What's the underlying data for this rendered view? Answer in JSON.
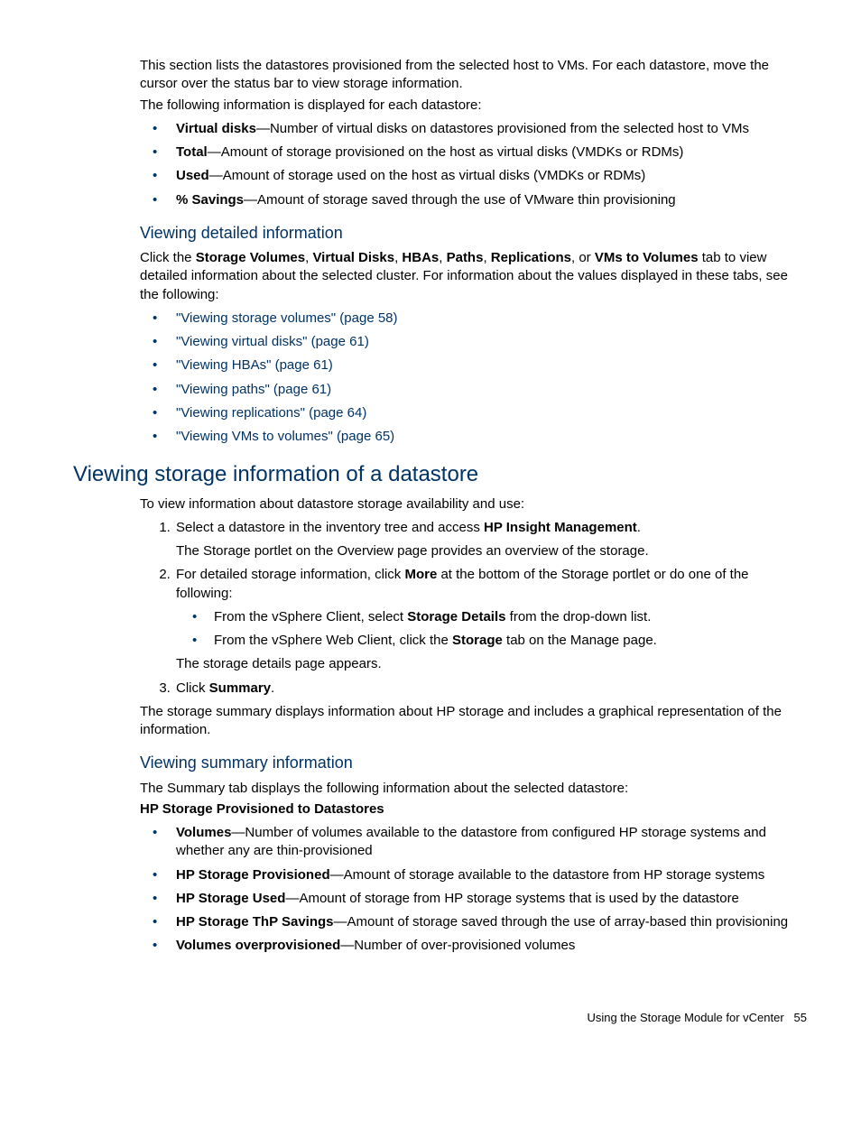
{
  "intro1": "This section lists the datastores provisioned from the selected host to VMs. For each datastore, move the cursor over the status bar to view storage information.",
  "intro2": "The following information is displayed for each datastore:",
  "list1": [
    {
      "term": "Virtual disks",
      "desc": "—Number of virtual disks on datastores provisioned from the selected host to VMs"
    },
    {
      "term": "Total",
      "desc": "—Amount of storage provisioned on the host as virtual disks (VMDKs or RDMs)"
    },
    {
      "term": "Used",
      "desc": "—Amount of storage used on the host as virtual disks (VMDKs or RDMs)"
    },
    {
      "term": "% Savings",
      "desc": "—Amount of storage saved through the use of VMware thin provisioning"
    }
  ],
  "h3_a": "Viewing detailed information",
  "detail_intro_pre": "Click the ",
  "detail_tabs": [
    "Storage Volumes",
    "Virtual Disks",
    "HBAs",
    "Paths",
    "Replications",
    "VMs to Volumes"
  ],
  "detail_intro_post": " tab to view detailed information about the selected cluster. For information about the values displayed in these tabs, see the following:",
  "links": [
    "\"Viewing storage volumes\" (page 58)",
    "\"Viewing virtual disks\" (page 61)",
    "\"Viewing HBAs\" (page 61)",
    "\"Viewing paths\" (page 61)",
    "\"Viewing replications\" (page 64)",
    "\"Viewing VMs to volumes\" (page 65)"
  ],
  "h2": "Viewing storage information of a datastore",
  "h2_intro": "To view information about datastore storage availability and use:",
  "step1_pre": "Select a datastore in the inventory tree and access ",
  "step1_bold": "HP Insight Management",
  "step1_post": ".",
  "step1_p": "The Storage portlet on the Overview page provides an overview of the storage.",
  "step2_pre": "For detailed storage information, click ",
  "step2_bold": "More",
  "step2_post": " at the bottom of the Storage portlet or do one of the following:",
  "step2_sub1_pre": "From the vSphere Client, select ",
  "step2_sub1_bold": "Storage Details",
  "step2_sub1_post": " from the drop-down list.",
  "step2_sub2_pre": "From the vSphere Web Client, click the ",
  "step2_sub2_bold": "Storage",
  "step2_sub2_post": " tab on the Manage page.",
  "step2_p": "The storage details page appears.",
  "step3_pre": "Click ",
  "step3_bold": "Summary",
  "step3_post": ".",
  "after_steps": "The storage summary displays information about HP storage and includes a graphical representation of the information.",
  "h3_b": "Viewing summary information",
  "summary_intro": "The Summary tab displays the following information about the selected datastore:",
  "summary_bold": "HP Storage Provisioned to Datastores",
  "list2": [
    {
      "term": "Volumes",
      "desc": "—Number of volumes available to the datastore from configured HP storage systems and whether any are thin-provisioned"
    },
    {
      "term": "HP Storage Provisioned",
      "desc": "—Amount of storage available to the datastore from HP storage systems"
    },
    {
      "term": "HP Storage Used",
      "desc": "—Amount of storage from HP storage systems that is used by the datastore"
    },
    {
      "term": "HP Storage ThP Savings",
      "desc": "—Amount of storage saved through the use of array-based thin provisioning"
    },
    {
      "term": "Volumes overprovisioned",
      "desc": "—Number of over-provisioned volumes"
    }
  ],
  "footer_text": "Using the Storage Module for vCenter",
  "footer_page": "55"
}
